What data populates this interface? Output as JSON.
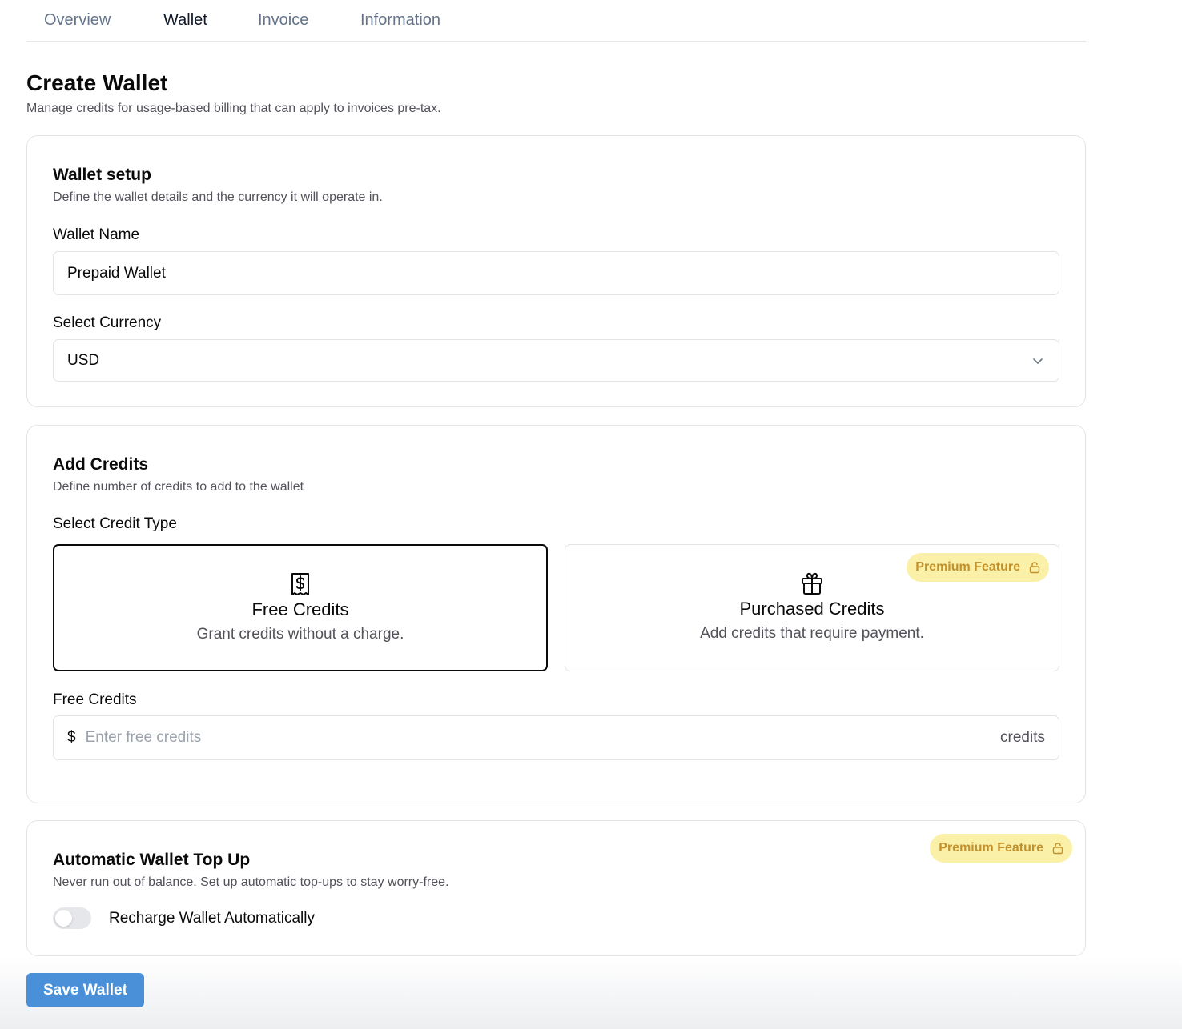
{
  "tabs": [
    {
      "label": "Overview",
      "active": false
    },
    {
      "label": "Wallet",
      "active": true
    },
    {
      "label": "Invoice",
      "active": false
    },
    {
      "label": "Information",
      "active": false
    }
  ],
  "header": {
    "title": "Create Wallet",
    "subtitle": "Manage credits for usage-based billing that can apply to invoices pre-tax."
  },
  "wallet_setup": {
    "title": "Wallet setup",
    "description": "Define the wallet details and the currency it will operate in.",
    "name_label": "Wallet Name",
    "name_value": "Prepaid Wallet",
    "currency_label": "Select Currency",
    "currency_value": "USD"
  },
  "add_credits": {
    "title": "Add Credits",
    "description": "Define number of credits to add to the wallet",
    "type_label": "Select Credit Type",
    "options": [
      {
        "title": "Free Credits",
        "description": "Grant credits without a charge.",
        "icon": "receipt-dollar-icon",
        "selected": true
      },
      {
        "title": "Purchased Credits",
        "description": "Add credits that require payment.",
        "icon": "gift-icon",
        "selected": false,
        "badge": "Premium Feature"
      }
    ],
    "free_credits_label": "Free Credits",
    "free_credits_prefix": "$",
    "free_credits_placeholder": "Enter free credits",
    "free_credits_suffix": "credits"
  },
  "top_up": {
    "title": "Automatic Wallet Top Up",
    "description": "Never run out of balance. Set up automatic top-ups to stay worry-free.",
    "badge": "Premium Feature",
    "toggle_label": "Recharge Wallet Automatically",
    "toggle_on": false
  },
  "actions": {
    "save_label": "Save Wallet"
  },
  "colors": {
    "accent": "#4a90d9",
    "badge_bg": "#fbf0a8",
    "badge_text": "#c2912b"
  }
}
